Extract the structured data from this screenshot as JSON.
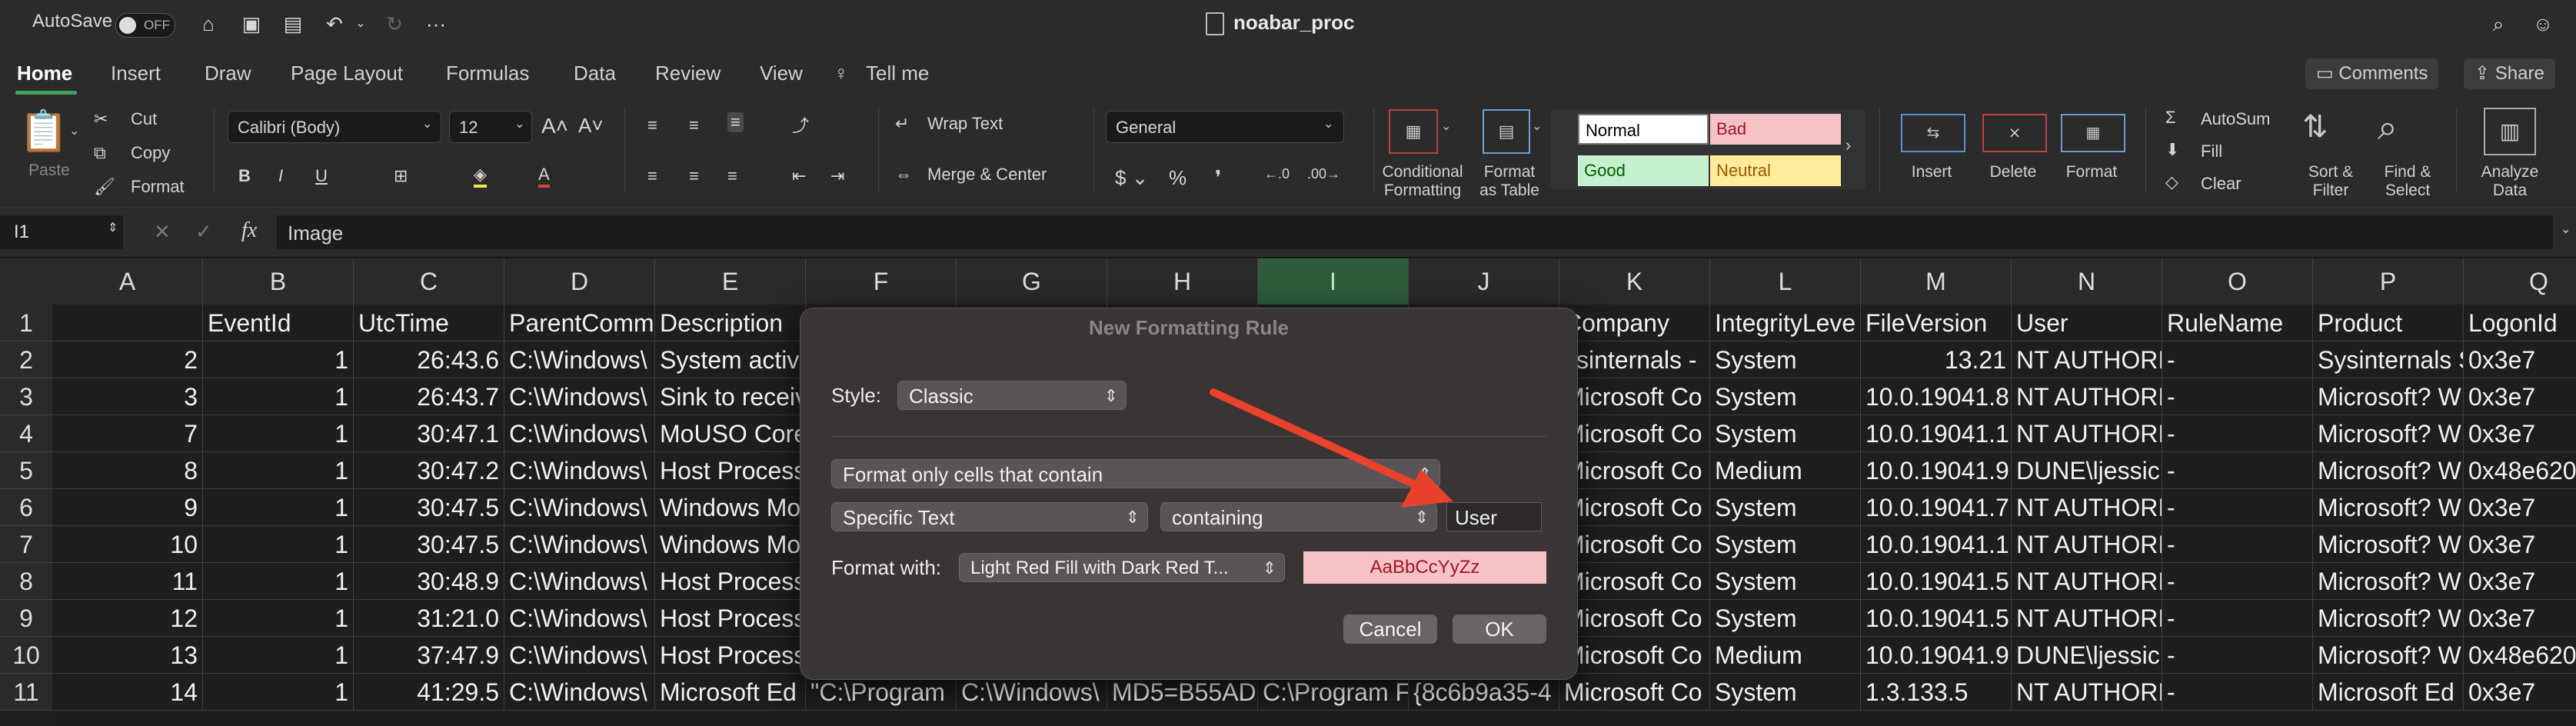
{
  "titlebar": {
    "autosave_label": "AutoSave",
    "autosave_state": "OFF",
    "doc_title": "noabar_proc",
    "more": "···"
  },
  "tabs": [
    "Home",
    "Insert",
    "Draw",
    "Page Layout",
    "Formulas",
    "Data",
    "Review",
    "View"
  ],
  "tell_me": "Tell me",
  "comments_label": "Comments",
  "share_label": "Share",
  "ribbon": {
    "paste": "Paste",
    "cut": "Cut",
    "copy": "Copy",
    "format": "Format",
    "font_name": "Calibri (Body)",
    "font_size": "12",
    "wrap_text": "Wrap Text",
    "merge_center": "Merge & Center",
    "number_format": "General",
    "conditional_formatting_1": "Conditional",
    "conditional_formatting_2": "Formatting",
    "format_as_table_1": "Format",
    "format_as_table_2": "as Table",
    "styles": {
      "normal": "Normal",
      "bad": "Bad",
      "good": "Good",
      "neutral": "Neutral"
    },
    "insert": "Insert",
    "delete": "Delete",
    "format_cells": "Format",
    "autosum": "AutoSum",
    "fill": "Fill",
    "clear": "Clear",
    "sort_filter_1": "Sort &",
    "sort_filter_2": "Filter",
    "find_select_1": "Find &",
    "find_select_2": "Select",
    "analyze_1": "Analyze",
    "analyze_2": "Data"
  },
  "formula_bar": {
    "cell_ref": "I1",
    "fx": "fx",
    "value": "Image"
  },
  "columns": [
    "A",
    "B",
    "C",
    "D",
    "E",
    "F",
    "G",
    "H",
    "I",
    "J",
    "K",
    "L",
    "M",
    "N",
    "O",
    "P",
    "Q"
  ],
  "rows": [
    "1",
    "2",
    "3",
    "4",
    "5",
    "6",
    "7",
    "8",
    "9",
    "10",
    "11"
  ],
  "cells": [
    [
      "",
      "EventId",
      "UtcTime",
      "ParentComm",
      "Description",
      "",
      "",
      "",
      "",
      "",
      "Company",
      "IntegrityLeve",
      "FileVersion",
      "User",
      "RuleName",
      "Product",
      "LogonId"
    ],
    [
      "2",
      "1",
      "26:43.6",
      "C:\\Windows\\",
      "System activ",
      "",
      "",
      "",
      "",
      "",
      "ysinternals -",
      "System",
      "13.21",
      "NT AUTHORI",
      "-",
      "Sysinternals S",
      "0x3e7"
    ],
    [
      "3",
      "1",
      "26:43.7",
      "C:\\Windows\\",
      "Sink to receiv",
      "",
      "",
      "",
      "",
      "",
      "Microsoft Co",
      "System",
      "10.0.19041.8",
      "NT AUTHORI",
      "-",
      "Microsoft? W",
      "0x3e7"
    ],
    [
      "7",
      "1",
      "30:47.1",
      "C:\\Windows\\",
      "MoUSO Core",
      "",
      "",
      "",
      "",
      "",
      "Microsoft Co",
      "System",
      "10.0.19041.1",
      "NT AUTHORI",
      "-",
      "Microsoft? W",
      "0x3e7"
    ],
    [
      "8",
      "1",
      "30:47.2",
      "C:\\Windows\\",
      "Host Process",
      "",
      "",
      "",
      "",
      "",
      "Microsoft Co",
      "Medium",
      "10.0.19041.9",
      "DUNE\\ljessic",
      "-",
      "Microsoft? W",
      "0x48e620"
    ],
    [
      "9",
      "1",
      "30:47.5",
      "C:\\Windows\\",
      "Windows Mo",
      "",
      "",
      "",
      "",
      "",
      "Microsoft Co",
      "System",
      "10.0.19041.7",
      "NT AUTHORI",
      "-",
      "Microsoft? W",
      "0x3e7"
    ],
    [
      "10",
      "1",
      "30:47.5",
      "C:\\Windows\\",
      "Windows Mo",
      "",
      "",
      "",
      "",
      "",
      "Microsoft Co",
      "System",
      "10.0.19041.1",
      "NT AUTHORI",
      "-",
      "Microsoft? W",
      "0x3e7"
    ],
    [
      "11",
      "1",
      "30:48.9",
      "C:\\Windows\\",
      "Host Process",
      "",
      "",
      "",
      "",
      "",
      "Microsoft Co",
      "System",
      "10.0.19041.5",
      "NT AUTHORI",
      "-",
      "Microsoft? W",
      "0x3e7"
    ],
    [
      "12",
      "1",
      "31:21.0",
      "C:\\Windows\\",
      "Host Process",
      "",
      "",
      "",
      "",
      "",
      "Microsoft Co",
      "System",
      "10.0.19041.5",
      "NT AUTHORI",
      "-",
      "Microsoft? W",
      "0x3e7"
    ],
    [
      "13",
      "1",
      "37:47.9",
      "C:\\Windows\\",
      "Host Process",
      "",
      "",
      "",
      "",
      "",
      "Microsoft Co",
      "Medium",
      "10.0.19041.9",
      "DUNE\\ljessic",
      "-",
      "Microsoft? W",
      "0x48e620"
    ],
    [
      "14",
      "1",
      "41:29.5",
      "C:\\Windows\\",
      "Microsoft Ed",
      "\"C:\\Program",
      "C:\\Windows\\",
      "MD5=B55AD",
      "C:\\Program F",
      "{8c6b9a35-4",
      "Microsoft Co",
      "System",
      "1.3.133.5",
      "NT AUTHORI",
      "-",
      "Microsoft Ed",
      "0x3e7"
    ]
  ],
  "dialog": {
    "title": "New Formatting Rule",
    "style_label": "Style:",
    "style_value": "Classic",
    "rule_type": "Format only cells that contain",
    "condition_type": "Specific Text",
    "operator": "containing",
    "text_value": "User",
    "format_with_label": "Format with:",
    "format_value": "Light Red Fill with Dark Red T...",
    "preview_text": "AaBbCcYyZz",
    "cancel": "Cancel",
    "ok": "OK"
  },
  "colors": {
    "accent_green": "#3ea55f",
    "arrow_red": "#e8412c",
    "preview_fill": "#f7c2c5",
    "preview_text": "#a0182a"
  }
}
